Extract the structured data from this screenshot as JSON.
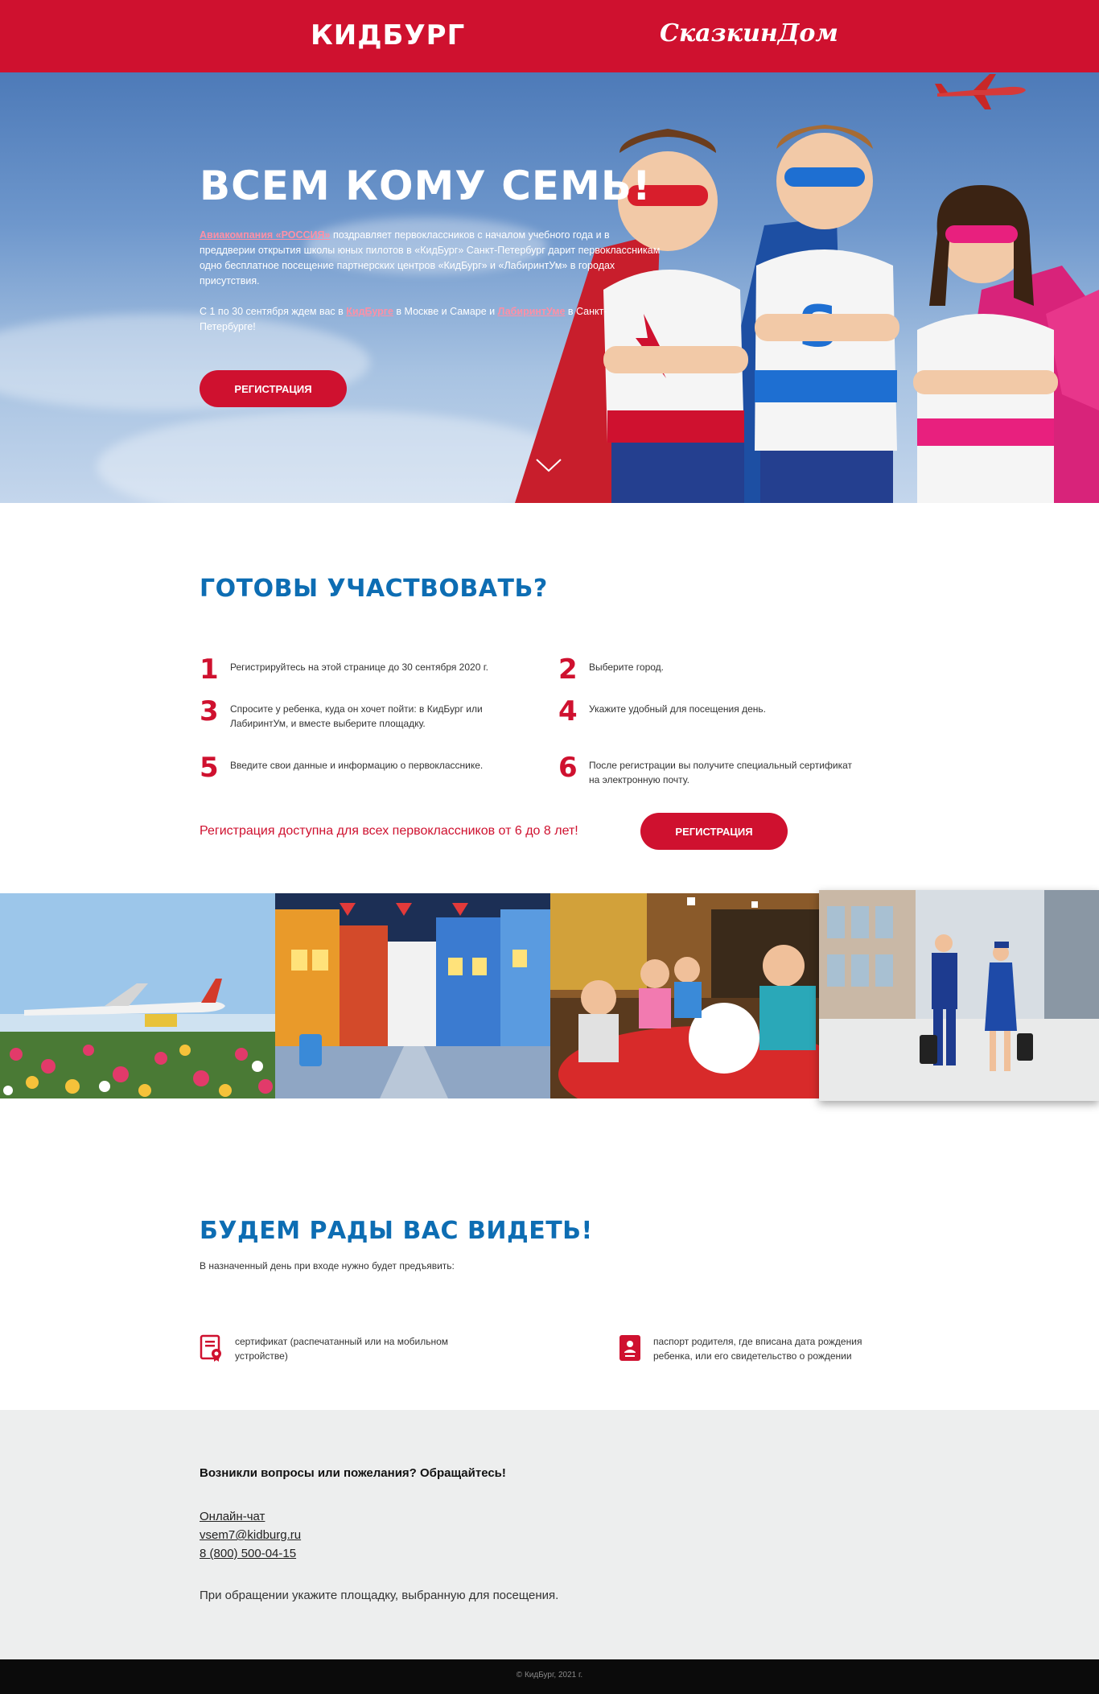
{
  "header": {
    "logo_left": "КИДБУРГ",
    "logo_right": "СказкинДом"
  },
  "hero": {
    "title": "ВСЕМ КОМУ СЕМЬ!",
    "p1_link": "Авиакомпания «РОССИЯ»",
    "p1_text": " поздравляет первоклассников с началом учебного года и в преддверии открытия школы юных пилотов в «КидБург» Санкт-Петербург дарит первоклассникам одно бесплатное посещение партнерских центров «КидБург» и «ЛабиринтУм» в городах присутствия.",
    "p2_a": "С 1 по 30 сентября ждем вас в ",
    "p2_link1": "КидБурге",
    "p2_b": " в Москве и Самаре и ",
    "p2_link2": "ЛабиринтУме",
    "p2_c": " в Санкт-Петербурге!",
    "button": "Регистрация"
  },
  "steps": {
    "title": "ГОТОВЫ УЧАСТВОВАТЬ?",
    "items": [
      {
        "num": "1",
        "text": "Регистрируйтесь на этой странице до 30 сентября 2020 г."
      },
      {
        "num": "2",
        "text": "Выберите город."
      },
      {
        "num": "3",
        "text": "Спросите у ребенка, куда он хочет пойти: в КидБург или ЛабиринтУм, и вместе выберите площадку."
      },
      {
        "num": "4",
        "text": "Укажите удобный для посещения день."
      },
      {
        "num": "5",
        "text": "Введите свои данные и информацию о первокласснике."
      },
      {
        "num": "6",
        "text": "После регистрации вы получите специальный сертификат на электронную почту."
      }
    ],
    "note": "Регистрация доступна для всех первоклассников от 6 до 8 лет!",
    "button": "Регистрация"
  },
  "welcome": {
    "title": "БУДЕМ РАДЫ ВАС ВИДЕТЬ!",
    "subtitle": "В назначенный день при входе нужно будет предъявить:",
    "req1": "сертификат (распечатанный или на мобильном устройстве)",
    "req2": "паспорт родителя, где вписана дата рождения ребенка, или его свидетельство о рождении",
    "icons": [
      "certificate-icon",
      "passport-icon"
    ]
  },
  "contacts": {
    "heading": "Возникли вопросы или пожелания? Обращайтесь!",
    "chat": "Онлайн-чат",
    "email": "vsem7@kidburg.ru",
    "phone": "8 (800) 500-04-15",
    "note": "При обращении укажите площадку, выбранную для посещения."
  },
  "footer": {
    "copyright": "© КидБург, 2021 г."
  },
  "colors": {
    "brand_red": "#cf112f",
    "title_blue": "#0d6db3",
    "contacts_bg": "#edeeee",
    "footer_bg": "#0b0b0b"
  }
}
